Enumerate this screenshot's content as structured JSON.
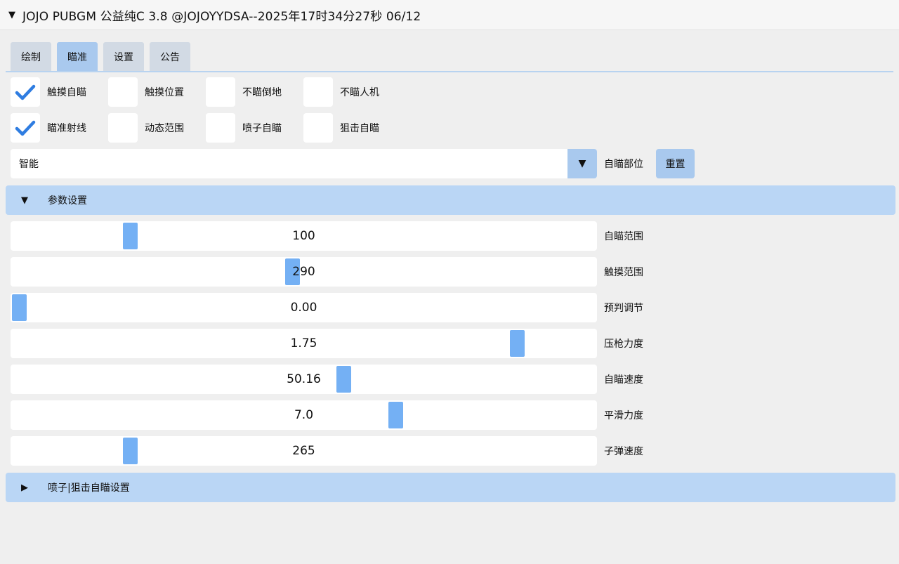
{
  "window": {
    "title": "JOJO PUBGM 公益纯C 3.8 @JOJOYYDSA--2025年17时34分27秒 06/12",
    "collapse_glyph": "▼"
  },
  "tabs": [
    {
      "label": "绘制",
      "active": false
    },
    {
      "label": "瞄准",
      "active": true
    },
    {
      "label": "设置",
      "active": false
    },
    {
      "label": "公告",
      "active": false
    }
  ],
  "checkboxes": {
    "row1": [
      {
        "label": "触摸自瞄",
        "checked": true
      },
      {
        "label": "触摸位置",
        "checked": false
      },
      {
        "label": "不瞄倒地",
        "checked": false
      },
      {
        "label": "不瞄人机",
        "checked": false
      }
    ],
    "row2": [
      {
        "label": "瞄准射线",
        "checked": true
      },
      {
        "label": "动态范围",
        "checked": false
      },
      {
        "label": "喷子自瞄",
        "checked": false
      },
      {
        "label": "狙击自瞄",
        "checked": false
      }
    ]
  },
  "aim_part": {
    "value": "智能",
    "arrow_glyph": "▼",
    "label": "自瞄部位",
    "reset_label": "重置"
  },
  "param_section": {
    "glyph": "▼",
    "label": "参数设置",
    "expanded": true
  },
  "sliders": [
    {
      "value_text": "100",
      "label": "自瞄范围",
      "fraction": 0.195
    },
    {
      "value_text": "290",
      "label": "触摸范围",
      "fraction": 0.48
    },
    {
      "value_text": "0.00",
      "label": "预判调节",
      "fraction": 0.0
    },
    {
      "value_text": "1.75",
      "label": "压枪力度",
      "fraction": 0.875
    },
    {
      "value_text": "50.16",
      "label": "自瞄速度",
      "fraction": 0.57
    },
    {
      "value_text": "7.0",
      "label": "平滑力度",
      "fraction": 0.662
    },
    {
      "value_text": "265",
      "label": "子弹速度",
      "fraction": 0.195
    }
  ],
  "shotgun_section": {
    "glyph": "▶",
    "label": "喷子|狙击自瞄设置",
    "expanded": false
  },
  "colors": {
    "accent": "#a9c9ee",
    "header": "#bad6f5",
    "grab": "#74b0f4",
    "check": "#2f7de1"
  }
}
